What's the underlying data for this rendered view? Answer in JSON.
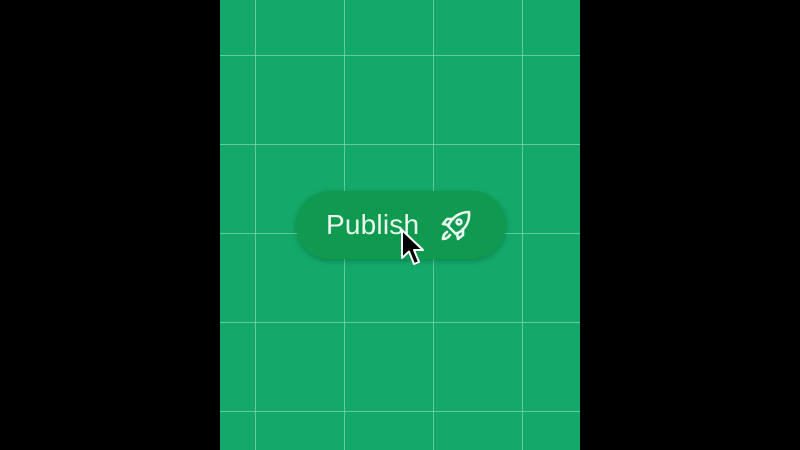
{
  "canvas": {
    "background_color": "#14a96b",
    "grid_line_color": "#7fd6a8",
    "letterbox_color": "#000000"
  },
  "publish_button": {
    "label": "Publish",
    "icon": "rocket-icon",
    "background_color": "#109a4f",
    "text_color": "#eaf7ef"
  },
  "pointer": {
    "icon": "mouse-pointer-arrow-icon"
  }
}
